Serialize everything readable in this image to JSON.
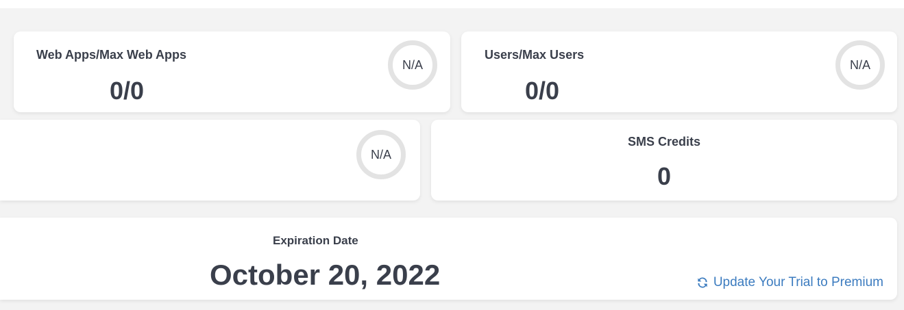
{
  "cards": {
    "web_apps": {
      "label": "Web Apps/Max Web Apps",
      "value": "0/0",
      "ring_text": "N/A"
    },
    "users": {
      "label": "Users/Max Users",
      "value": "0/0",
      "ring_text": "N/A"
    },
    "partial": {
      "ring_text": "N/A"
    },
    "sms": {
      "label": "SMS Credits",
      "value": "0"
    },
    "expiration": {
      "label": "Expiration Date",
      "value": "October 20, 2022",
      "upgrade_link": "Update Your Trial to Premium",
      "upgrade_icon": "refresh-icon"
    }
  },
  "colors": {
    "text": "#3a3f4b",
    "link": "#3b7bbf",
    "ring": "#e3e3e3",
    "background": "#f3f3f3"
  }
}
